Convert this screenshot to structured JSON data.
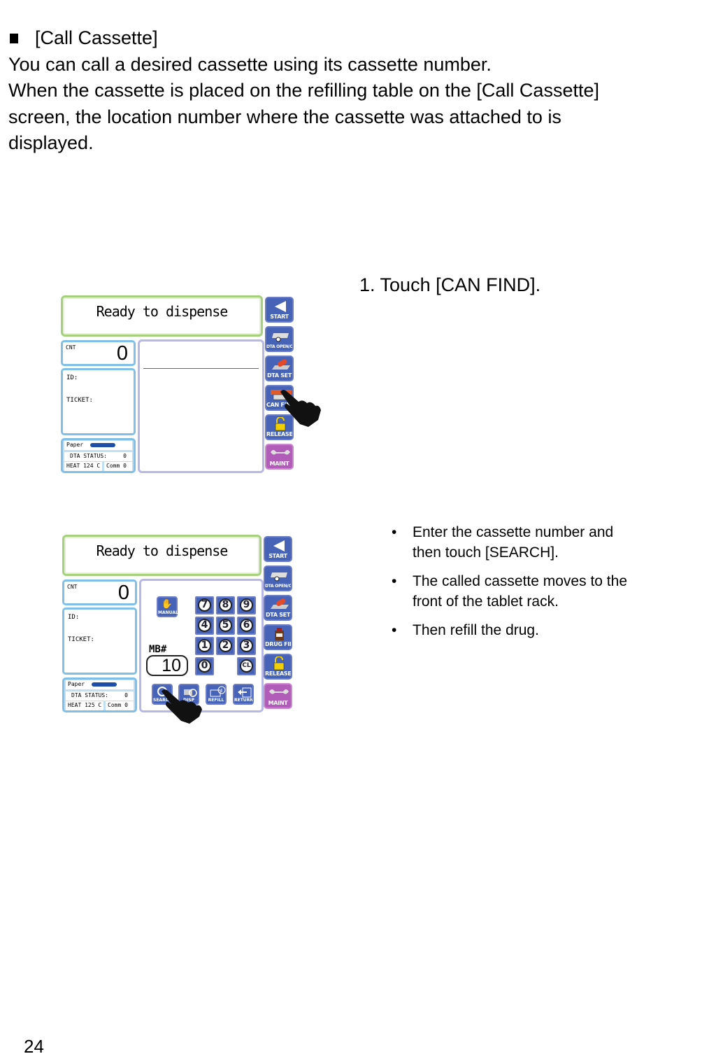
{
  "intro": {
    "heading": "[Call Cassette]",
    "lines": [
      "You can call a desired cassette using its cassette number.",
      "When the cassette is placed on the refilling table on the [Call Cassette]",
      "screen, the location number where the cassette was attached to is",
      "displayed."
    ]
  },
  "step1": {
    "title": "1. Touch [CAN FIND]."
  },
  "bullets": [
    "Enter the cassette number and then touch [SEARCH].",
    "The called cassette moves to the front of the tablet rack.",
    "Then refill the drug."
  ],
  "page_number": "24",
  "screen1": {
    "status_message": "Ready to dispense",
    "cnt_label": "CNT",
    "cnt_value": "0",
    "id_label": "ID:",
    "ticket_label": "TICKET:",
    "paper_label": "Paper",
    "dta_status_label": "DTA STATUS:",
    "dta_status_value": "0",
    "heat_label": "HEAT 124  C",
    "comm_label": "Comm 0",
    "side_buttons": [
      {
        "label": "START",
        "icon": "start-arrow-icon"
      },
      {
        "label": "DTA OPEN/CLOSE",
        "icon": "dta-tray-icon"
      },
      {
        "label": "DTA SET",
        "icon": "dta-set-icon"
      },
      {
        "label": "CAN FIND",
        "icon": "can-find-icon"
      },
      {
        "label": "RELEASE",
        "icon": "padlock-icon"
      },
      {
        "label": "MAINT",
        "icon": "wrench-icon"
      }
    ],
    "hand_pointer_target": "CAN FIND"
  },
  "screen2": {
    "status_message": "Ready to dispense",
    "cnt_label": "CNT",
    "cnt_value": "0",
    "id_label": "ID:",
    "ticket_label": "TICKET:",
    "paper_label": "Paper",
    "dta_status_label": "DTA STATUS:",
    "dta_status_value": "0",
    "heat_label": "HEAT 125  C",
    "comm_label": "Comm 0",
    "manual_label": "MANUAL",
    "mb_label": "MB#",
    "mb_value": "10",
    "keypad": [
      "7",
      "8",
      "9",
      "4",
      "5",
      "6",
      "1",
      "2",
      "3",
      "0",
      "CL"
    ],
    "bottom_buttons": [
      {
        "label": "SEARCH",
        "icon": "magnifier-icon"
      },
      {
        "label": "DISP",
        "icon": "cassette-search-icon"
      },
      {
        "label": "REFILL",
        "icon": "refill-info-icon"
      },
      {
        "label": "RETURN",
        "icon": "return-arrow-icon"
      }
    ],
    "side_buttons": [
      {
        "label": "START",
        "icon": "start-arrow-icon"
      },
      {
        "label": "DTA OPEN/CLOSE",
        "icon": "dta-tray-icon"
      },
      {
        "label": "DTA SET",
        "icon": "dta-set-icon"
      },
      {
        "label": "DRUG FIND",
        "icon": "drug-bottle-icon"
      },
      {
        "label": "RELEASE",
        "icon": "padlock-icon"
      },
      {
        "label": "MAINT",
        "icon": "wrench-icon"
      }
    ],
    "hand_pointer_target": "SEARCH"
  }
}
